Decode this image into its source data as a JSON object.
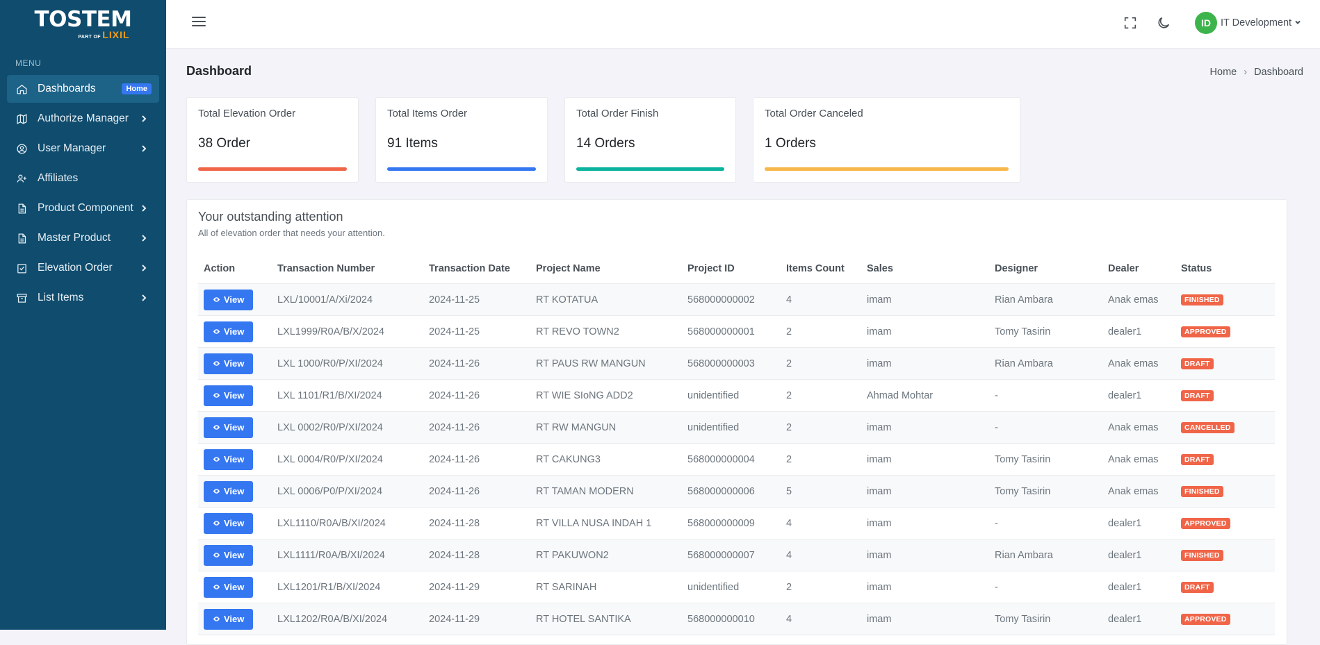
{
  "brand": {
    "name": "TOSTEM",
    "sub_prefix": "PART OF",
    "sub_brand": "LIXIL"
  },
  "sidebar": {
    "menu_title": "MENU",
    "items": [
      {
        "label": "Dashboards",
        "icon": "home-icon",
        "badge": "Home",
        "active": true
      },
      {
        "label": "Authorize Manager",
        "icon": "map-icon",
        "chevron": true
      },
      {
        "label": "User Manager",
        "icon": "user-circle-icon",
        "chevron": true
      },
      {
        "label": "Affiliates",
        "icon": "user-plus-icon"
      },
      {
        "label": "Product Component",
        "icon": "file-icon",
        "chevron": true
      },
      {
        "label": "Master Product",
        "icon": "file-text-icon",
        "chevron": true
      },
      {
        "label": "Elevation Order",
        "icon": "clipboard-check-icon",
        "chevron": true
      },
      {
        "label": "List Items",
        "icon": "archive-icon",
        "chevron": true
      }
    ]
  },
  "topbar": {
    "user_initials": "ID",
    "user_name": "IT Development"
  },
  "page": {
    "title": "Dashboard",
    "breadcrumb": [
      "Home",
      "Dashboard"
    ]
  },
  "stats": [
    {
      "label": "Total Elevation Order",
      "value": "38 Order",
      "color": "#f06548"
    },
    {
      "label": "Total Items Order",
      "value": "91 Items",
      "color": "#3577f1"
    },
    {
      "label": "Total Order Finish",
      "value": "14 Orders",
      "color": "#0ab39c"
    },
    {
      "label": "Total Order Canceled",
      "value": "1 Orders",
      "color": "#f7b84b"
    }
  ],
  "attention": {
    "title": "Your outstanding attention",
    "subtitle": "All of elevation order that needs your attention.",
    "columns": [
      "Action",
      "Transaction Number",
      "Transaction Date",
      "Project Name",
      "Project ID",
      "Items Count",
      "Sales",
      "Designer",
      "Dealer",
      "Status"
    ],
    "view_label": "View",
    "rows": [
      {
        "txn": "LXL/10001/A/Xi/2024",
        "date": "2024-11-25",
        "project": "RT KOTATUA",
        "pid": "568000000002",
        "count": "4",
        "sales": "imam",
        "designer": "Rian Ambara",
        "dealer": "Anak emas",
        "status": "FINISHED"
      },
      {
        "txn": "LXL1999/R0A/B/X/2024",
        "date": "2024-11-25",
        "project": "RT REVO TOWN2",
        "pid": "568000000001",
        "count": "2",
        "sales": "imam",
        "designer": "Tomy Tasirin",
        "dealer": "dealer1",
        "status": "APPROVED"
      },
      {
        "txn": "LXL 1000/R0/P/XI/2024",
        "date": "2024-11-26",
        "project": "RT PAUS RW MANGUN",
        "pid": "568000000003",
        "count": "2",
        "sales": "imam",
        "designer": "Rian Ambara",
        "dealer": "Anak emas",
        "status": "DRAFT"
      },
      {
        "txn": "LXL 1101/R1/B/XI/2024",
        "date": "2024-11-26",
        "project": "RT WIE SIoNG ADD2",
        "pid": "unidentified",
        "count": "2",
        "sales": "Ahmad Mohtar",
        "designer": "-",
        "dealer": "dealer1",
        "status": "DRAFT"
      },
      {
        "txn": "LXL 0002/R0/P/XI/2024",
        "date": "2024-11-26",
        "project": "RT RW MANGUN",
        "pid": "unidentified",
        "count": "2",
        "sales": "imam",
        "designer": "-",
        "dealer": "Anak emas",
        "status": "CANCELLED"
      },
      {
        "txn": "LXL 0004/R0/P/XI/2024",
        "date": "2024-11-26",
        "project": "RT CAKUNG3",
        "pid": "568000000004",
        "count": "2",
        "sales": "imam",
        "designer": "Tomy Tasirin",
        "dealer": "Anak emas",
        "status": "DRAFT"
      },
      {
        "txn": "LXL 0006/P0/P/XI/2024",
        "date": "2024-11-26",
        "project": "RT TAMAN MODERN",
        "pid": "568000000006",
        "count": "5",
        "sales": "imam",
        "designer": "Tomy Tasirin",
        "dealer": "Anak emas",
        "status": "FINISHED"
      },
      {
        "txn": "LXL1110/R0A/B/XI/2024",
        "date": "2024-11-28",
        "project": "RT VILLA NUSA INDAH 1",
        "pid": "568000000009",
        "count": "4",
        "sales": "imam",
        "designer": "-",
        "dealer": "dealer1",
        "status": "APPROVED"
      },
      {
        "txn": "LXL1111/R0A/B/XI/2024",
        "date": "2024-11-28",
        "project": "RT PAKUWON2",
        "pid": "568000000007",
        "count": "4",
        "sales": "imam",
        "designer": "Rian Ambara",
        "dealer": "dealer1",
        "status": "FINISHED"
      },
      {
        "txn": "LXL1201/R1/B/XI/2024",
        "date": "2024-11-29",
        "project": "RT SARINAH",
        "pid": "unidentified",
        "count": "2",
        "sales": "imam",
        "designer": "-",
        "dealer": "dealer1",
        "status": "DRAFT"
      },
      {
        "txn": "LXL1202/R0A/B/XI/2024",
        "date": "2024-11-29",
        "project": "RT HOTEL SANTIKA",
        "pid": "568000000010",
        "count": "4",
        "sales": "imam",
        "designer": "Tomy Tasirin",
        "dealer": "dealer1",
        "status": "APPROVED"
      }
    ]
  }
}
